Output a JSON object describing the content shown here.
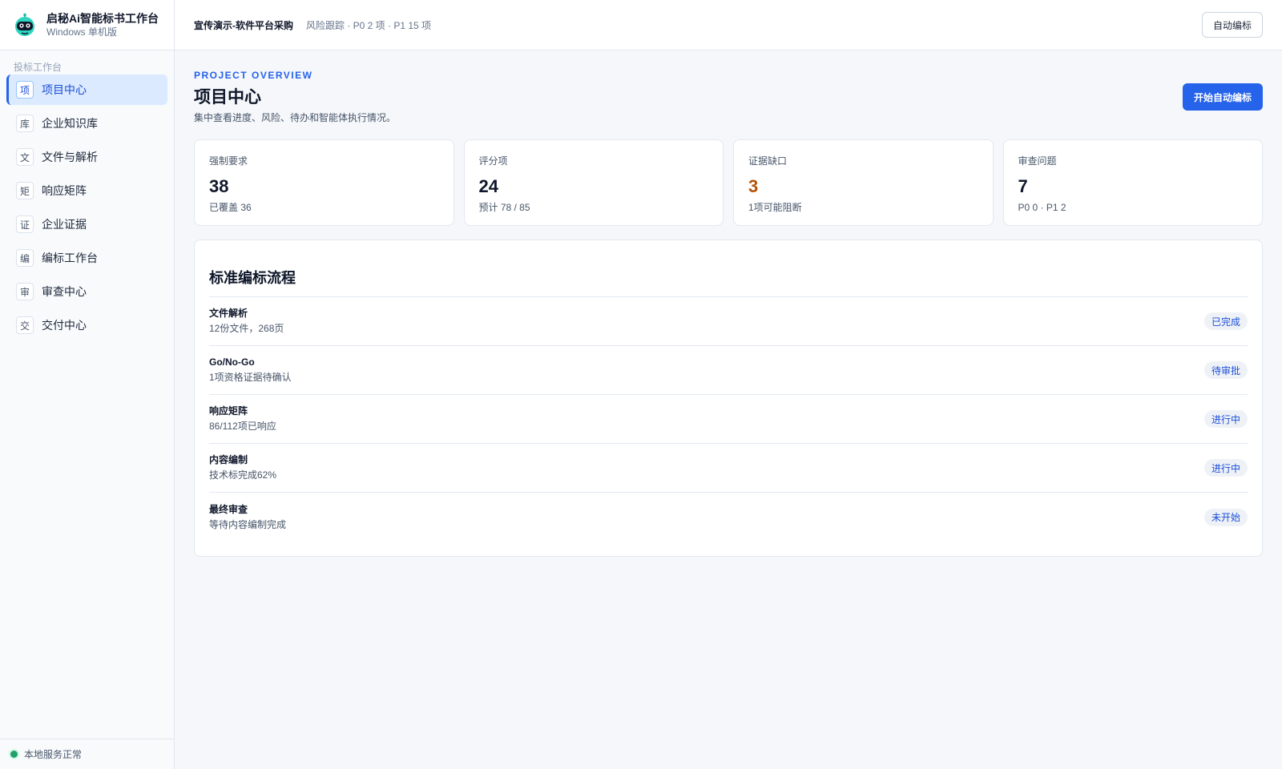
{
  "app": {
    "title": "启秘Ai智能标书工作台",
    "subtitle": "Windows 单机版"
  },
  "sidebar": {
    "section_label": "投标工作台",
    "items": [
      {
        "icon": "项",
        "label": "项目中心",
        "active": true
      },
      {
        "icon": "库",
        "label": "企业知识库"
      },
      {
        "icon": "文",
        "label": "文件与解析"
      },
      {
        "icon": "矩",
        "label": "响应矩阵"
      },
      {
        "icon": "证",
        "label": "企业证据"
      },
      {
        "icon": "编",
        "label": "编标工作台"
      },
      {
        "icon": "审",
        "label": "审查中心"
      },
      {
        "icon": "交",
        "label": "交付中心"
      }
    ],
    "status_text": "本地服务正常",
    "status_color": "#22a06b"
  },
  "topbar": {
    "project_name": "宣传演示-软件平台采购",
    "risk_summary": "风险跟踪 · P0 2 项 · P1 15 项",
    "button_label": "自动编标"
  },
  "page": {
    "eyebrow": "PROJECT OVERVIEW",
    "title": "项目中心",
    "description": "集中查看进度、风险、待办和智能体执行情况。",
    "primary_button": "开始自动编标"
  },
  "stats": [
    {
      "label": "强制要求",
      "value": "38",
      "sub": "已覆盖 36"
    },
    {
      "label": "评分项",
      "value": "24",
      "sub": "预计 78 / 85"
    },
    {
      "label": "证据缺口",
      "value": "3",
      "sub": "1项可能阻断",
      "value_color": "#b45309"
    },
    {
      "label": "审查问题",
      "value": "7",
      "sub": "P0 0 · P1 2"
    }
  ],
  "flow": {
    "title": "标准编标流程",
    "steps": [
      {
        "name": "文件解析",
        "desc": "12份文件，268页",
        "status": "已完成"
      },
      {
        "name": "Go/No-Go",
        "desc": "1项资格证据待确认",
        "status": "待审批"
      },
      {
        "name": "响应矩阵",
        "desc": "86/112项已响应",
        "status": "进行中"
      },
      {
        "name": "内容编制",
        "desc": "技术标完成62%",
        "status": "进行中"
      },
      {
        "name": "最终审查",
        "desc": "等待内容编制完成",
        "status": "未开始"
      }
    ]
  },
  "colors": {
    "accent": "#2563eb",
    "warning": "#b45309"
  }
}
